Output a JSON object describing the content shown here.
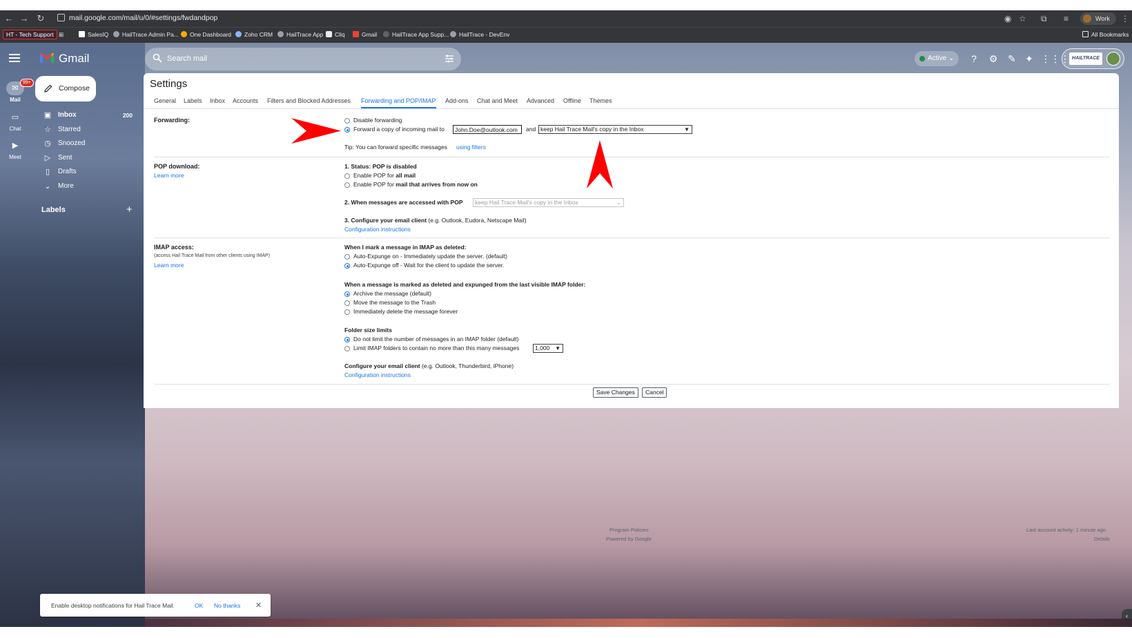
{
  "browser": {
    "url": "mail.google.com/mail/u/0/#settings/fwdandpop",
    "profile": "Work",
    "bookmarks": [
      {
        "label": "HT - Tech Support"
      },
      {
        "label": "SalesIQ"
      },
      {
        "label": "HailTrace Admin Pa..."
      },
      {
        "label": "One Dashboard"
      },
      {
        "label": "Zoho CRM"
      },
      {
        "label": "HailTrace App"
      },
      {
        "label": "Cliq"
      },
      {
        "label": "Gmail"
      },
      {
        "label": "HailTrace App Supp..."
      },
      {
        "label": "HailTrace - DevEnv"
      }
    ],
    "all_bookmarks": "All Bookmarks"
  },
  "gmail": {
    "brand": "Gmail",
    "search_placeholder": "Search mail",
    "status": "Active",
    "org_logo_text": "HAILTRACE"
  },
  "rail": {
    "mail": "Mail",
    "mail_badge": "99+",
    "chat": "Chat",
    "meet": "Meet"
  },
  "nav": {
    "compose": "Compose",
    "items": [
      {
        "label": "Inbox",
        "count": "200"
      },
      {
        "label": "Starred"
      },
      {
        "label": "Snoozed"
      },
      {
        "label": "Sent"
      },
      {
        "label": "Drafts"
      },
      {
        "label": "More"
      }
    ],
    "labels_header": "Labels"
  },
  "settings": {
    "title": "Settings",
    "tabs": [
      "General",
      "Labels",
      "Inbox",
      "Accounts",
      "Filters and Blocked Addresses",
      "Forwarding and POP/IMAP",
      "Add-ons",
      "Chat and Meet",
      "Advanced",
      "Offline",
      "Themes"
    ],
    "selected_tab": "Forwarding and POP/IMAP",
    "forwarding": {
      "label": "Forwarding:",
      "disable": "Disable forwarding",
      "forward_prefix": "Forward a copy of incoming mail to",
      "email": "John.Doe@outlook.com",
      "and": "and",
      "action": "keep Hail Trace Mail's copy in the Inbox",
      "tip": "Tip: You can forward specific messages",
      "tip_link": "using filters"
    },
    "pop": {
      "label": "POP download:",
      "learn_more": "Learn more",
      "status": "1. Status: POP is disabled",
      "enable_all_prefix": "Enable POP for",
      "enable_all_bold": "all mail",
      "enable_new_prefix": "Enable POP for",
      "enable_new_bold": "mail that arrives from now on",
      "when_accessed": "2. When messages are accessed with POP",
      "when_accessed_value": "keep Hail Trace Mail's copy in the Inbox",
      "configure_bold": "3. Configure your email client",
      "configure_rest": "(e.g. Outlook, Eudora, Netscape Mail)",
      "config_link": "Configuration instructions"
    },
    "imap": {
      "label": "IMAP access:",
      "note": "(access Hail Trace Mail from other clients using IMAP)",
      "learn_more": "Learn more",
      "deleted_header": "When I mark a message in IMAP as deleted:",
      "expunge_on": "Auto-Expunge on - Immediately update the server. (default)",
      "expunge_off": "Auto-Expunge off - Wait for the client to update the server.",
      "expunged_header": "When a message is marked as deleted and expunged from the last visible IMAP folder:",
      "archive": "Archive the message (default)",
      "trash": "Move the message to the Trash",
      "delete_forever": "Immediately delete the message forever",
      "folder_header": "Folder size limits",
      "no_limit": "Do not limit the number of messages in an IMAP folder (default)",
      "limit": "Limit IMAP folders to contain no more than this many messages",
      "limit_value": "1,000",
      "configure_bold": "Configure your email client",
      "configure_rest": "(e.g. Outlook, Thunderbird, iPhone)",
      "config_link": "Configuration instructions"
    },
    "save": "Save Changes",
    "cancel": "Cancel"
  },
  "footer": {
    "policies": "Program Policies",
    "powered": "Powered by Google",
    "activity": "Last account activity: 1 minute ago",
    "details": "Details"
  },
  "toast": {
    "message": "Enable desktop notifications for Hail Trace Mail.",
    "ok": "OK",
    "no_thanks": "No thanks"
  },
  "colors": {
    "accent": "#1a73e8",
    "annotation_arrow": "#ff0000"
  }
}
